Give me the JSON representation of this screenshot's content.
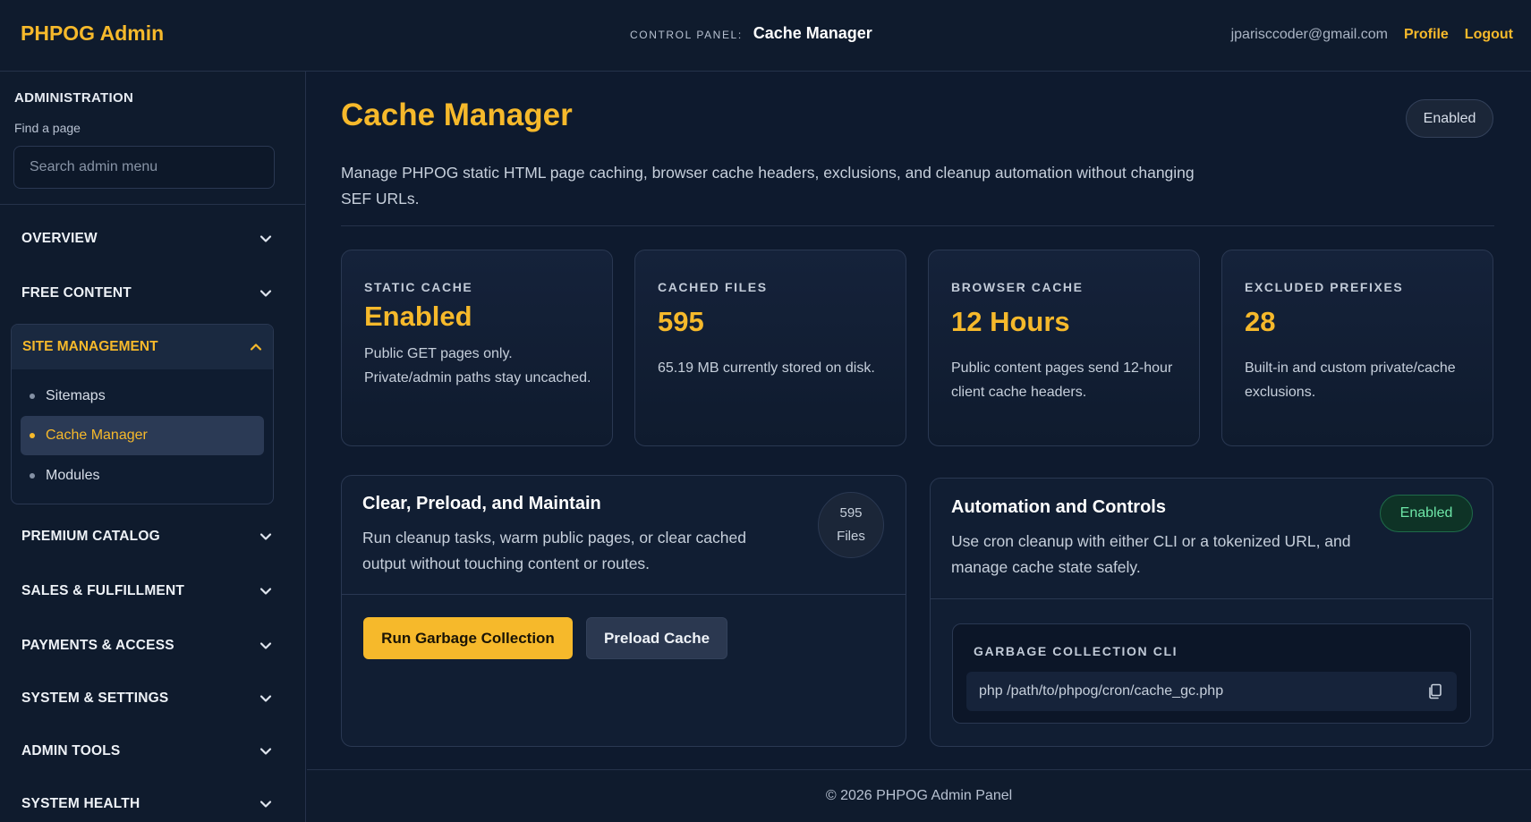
{
  "header": {
    "brand": "PHPOG Admin",
    "control_label": "CONTROL PANEL:",
    "control_title": "Cache Manager",
    "user_email": "jparisccoder@gmail.com",
    "profile_label": "Profile",
    "logout_label": "Logout"
  },
  "sidebar": {
    "section_title": "ADMINISTRATION",
    "find_label": "Find a page",
    "search_placeholder": "Search admin menu",
    "items_before": [
      {
        "label": "OVERVIEW"
      },
      {
        "label": "FREE CONTENT"
      }
    ],
    "open_group": {
      "label": "SITE MANAGEMENT",
      "children": [
        {
          "label": "Sitemaps"
        },
        {
          "label": "Cache Manager",
          "active": true
        },
        {
          "label": "Modules"
        }
      ]
    },
    "items_after": [
      {
        "label": "PREMIUM CATALOG"
      },
      {
        "label": "SALES & FULFILLMENT"
      },
      {
        "label": "PAYMENTS & ACCESS"
      },
      {
        "label": "SYSTEM & SETTINGS"
      },
      {
        "label": "ADMIN TOOLS"
      },
      {
        "label": "SYSTEM HEALTH"
      }
    ]
  },
  "main": {
    "title": "Cache Manager",
    "status_pill": "Enabled",
    "description": "Manage PHPOG static HTML page caching, browser cache headers, exclusions, and cleanup automation without changing SEF URLs.",
    "stats": [
      {
        "label": "STATIC CACHE",
        "value": "Enabled",
        "desc": "Public GET pages only. Private/admin paths stay uncached."
      },
      {
        "label": "CACHED FILES",
        "value": "595",
        "desc": "65.19 MB currently stored on disk."
      },
      {
        "label": "BROWSER CACHE",
        "value": "12 Hours",
        "desc": "Public content pages send 12-hour client cache headers."
      },
      {
        "label": "EXCLUDED PREFIXES",
        "value": "28",
        "desc": "Built-in and custom private/cache exclusions."
      }
    ],
    "maintain_panel": {
      "title": "Clear, Preload, and Maintain",
      "desc": "Run cleanup tasks, warm public pages, or clear cached output without touching content or routes.",
      "badge_count": "595",
      "badge_unit": "Files",
      "gc_button": "Run Garbage Collection",
      "preload_button": "Preload Cache"
    },
    "automation_panel": {
      "title": "Automation and Controls",
      "desc": "Use cron cleanup with either CLI or a tokenized URL, and manage cache state safely.",
      "status": "Enabled",
      "cli_label": "GARBAGE COLLECTION CLI",
      "cli_command": "php /path/to/phpog/cron/cache_gc.php"
    }
  },
  "footer": {
    "text": "© 2026 PHPOG Admin Panel"
  },
  "colors": {
    "accent": "#f6b92b",
    "background": "#0e1a2e",
    "success": "#6ee7a8"
  },
  "icons": {
    "chevron_down": "chevron-down-icon",
    "chevron_up": "chevron-up-icon",
    "copy": "copy-icon"
  }
}
